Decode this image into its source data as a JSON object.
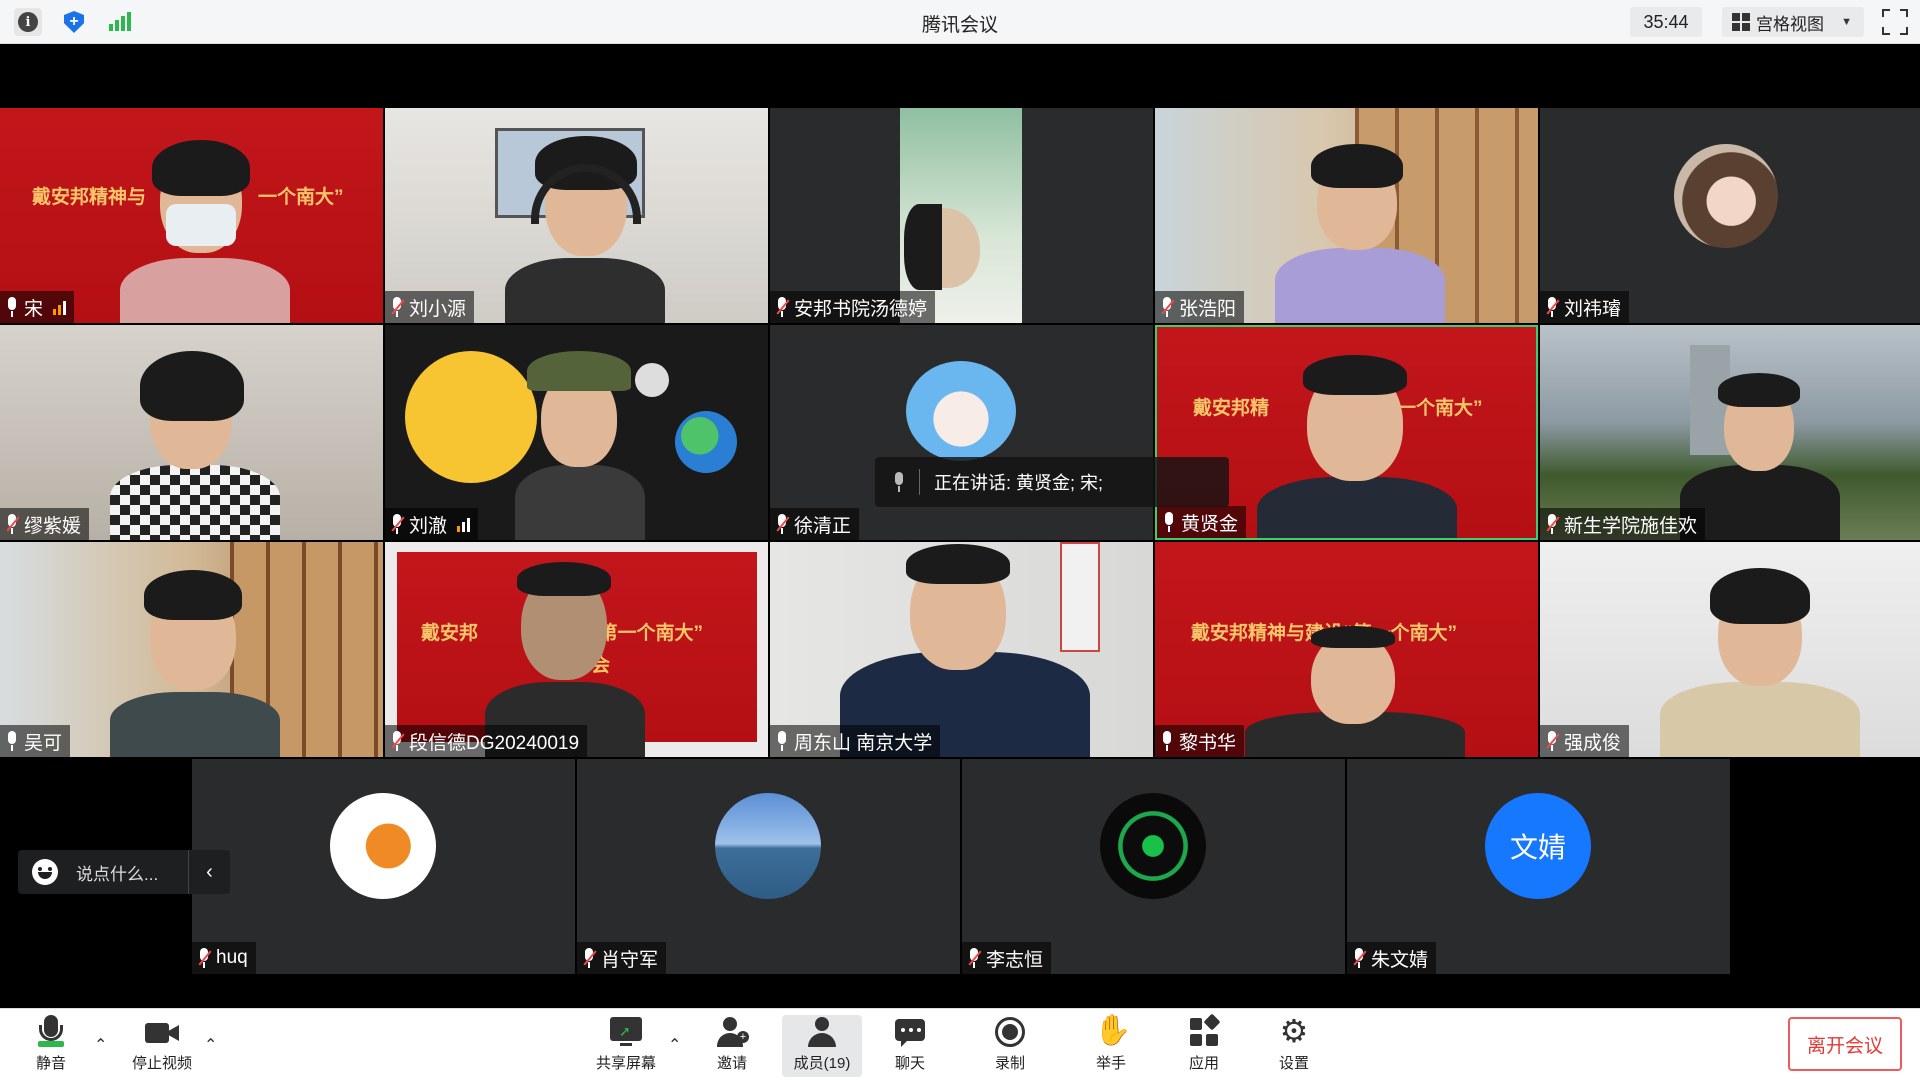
{
  "titlebar": {
    "title": "腾讯会议",
    "timer": "35:44",
    "view_mode": "宫格视图"
  },
  "participants": [
    {
      "name": "宋",
      "muted": false
    },
    {
      "name": "刘小源",
      "muted": true
    },
    {
      "name": "安邦书院汤德婷",
      "muted": true
    },
    {
      "name": "张浩阳",
      "muted": true
    },
    {
      "name": "刘祎璿",
      "muted": true
    },
    {
      "name": "缪紫媛",
      "muted": true
    },
    {
      "name": "刘澈",
      "muted": true
    },
    {
      "name": "徐清正",
      "muted": true
    },
    {
      "name": "黄贤金",
      "muted": false
    },
    {
      "name": "新生学院施佳欢",
      "muted": true
    },
    {
      "name": "吴可",
      "muted": false
    },
    {
      "name": "段信德DG20240019",
      "muted": true
    },
    {
      "name": "周东山 南京大学",
      "muted": false
    },
    {
      "name": "黎书华",
      "muted": false
    },
    {
      "name": "强成俊",
      "muted": true
    },
    {
      "name": "huq",
      "muted": true
    },
    {
      "name": "肖守军",
      "muted": true
    },
    {
      "name": "李志恒",
      "muted": true
    },
    {
      "name": "朱文婧",
      "muted": true,
      "avatar_text": "文婧"
    }
  ],
  "banners": {
    "b1_left": "戴安邦精神与",
    "b1_right": "一个南大”",
    "b9_left": "戴安邦精",
    "b9_right": "一个南大”",
    "b12_left": "戴安邦",
    "b12_right": "“第一个南大”",
    "b12_extra": "会",
    "b14": "戴安邦精神与建设“第一个南大”"
  },
  "speaking": {
    "text": "正在讲话: 黄贤金; 宋;"
  },
  "chat": {
    "placeholder": "说点什么..."
  },
  "toolbar": {
    "mute": "静音",
    "stop_video": "停止视频",
    "share_screen": "共享屏幕",
    "invite": "邀请",
    "members": "成员(19)",
    "chat": "聊天",
    "record": "录制",
    "raise_hand": "举手",
    "apps": "应用",
    "settings": "设置",
    "leave": "离开会议"
  },
  "colors": {
    "mute_slash": "#f24a4a",
    "accent_blue": "#1677ff",
    "leave_red": "#e53935",
    "banner_red": "#c2161b"
  }
}
